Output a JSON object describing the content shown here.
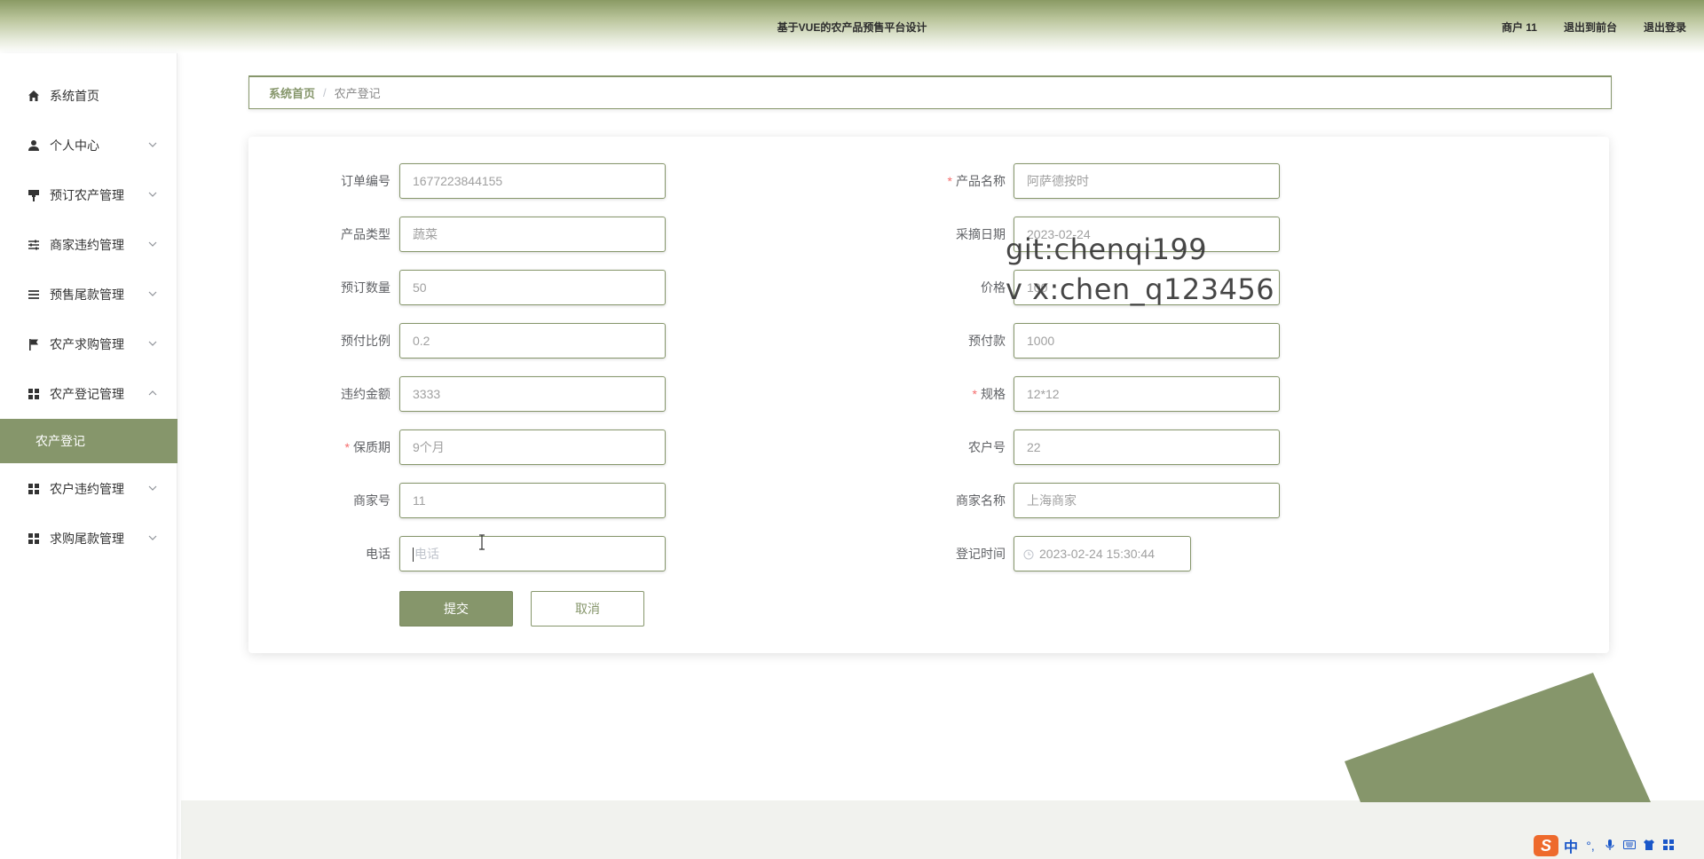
{
  "header": {
    "title": "基于VUE的农产品预售平台设计",
    "user": "商户 11",
    "to_front": "退出到前台",
    "logout": "退出登录"
  },
  "sidebar": {
    "items": [
      {
        "label": "系统首页",
        "icon": "home-icon"
      },
      {
        "label": "个人中心",
        "icon": "user-icon"
      },
      {
        "label": "预订农产管理",
        "icon": "brush-icon"
      },
      {
        "label": "商家违约管理",
        "icon": "sliders-icon"
      },
      {
        "label": "预售尾款管理",
        "icon": "list-icon"
      },
      {
        "label": "农产求购管理",
        "icon": "flag-icon"
      },
      {
        "label": "农产登记管理",
        "icon": "grid-icon"
      },
      {
        "label": "农户违约管理",
        "icon": "grid-icon"
      },
      {
        "label": "求购尾款管理",
        "icon": "grid-icon"
      }
    ],
    "active_sub": "农产登记"
  },
  "breadcrumb": {
    "home": "系统首页",
    "separator": "/",
    "current": "农产登记"
  },
  "form": {
    "order_no": {
      "label": "订单编号",
      "value": "1677223844155"
    },
    "product_name": {
      "label": "产品名称",
      "value": "阿萨德按时"
    },
    "product_type": {
      "label": "产品类型",
      "value": "蔬菜"
    },
    "pick_date": {
      "label": "采摘日期",
      "value": "2023-02-24"
    },
    "order_qty": {
      "label": "预订数量",
      "value": "50"
    },
    "price": {
      "label": "价格",
      "value": "100"
    },
    "pay_ratio": {
      "label": "预付比例",
      "value": "0.2"
    },
    "prepay": {
      "label": "预付款",
      "value": "1000"
    },
    "penalty": {
      "label": "违约金额",
      "value": "3333"
    },
    "spec": {
      "label": "规格",
      "value": "12*12"
    },
    "shelf_life": {
      "label": "保质期",
      "value": "9个月"
    },
    "farmer_no": {
      "label": "农户号",
      "value": "22"
    },
    "merchant_no": {
      "label": "商家号",
      "value": "11"
    },
    "merchant_name": {
      "label": "商家名称",
      "value": "上海商家"
    },
    "phone": {
      "label": "电话",
      "placeholder": "电话"
    },
    "register_time": {
      "label": "登记时间",
      "value": "2023-02-24 15:30:44"
    }
  },
  "buttons": {
    "submit": "提交",
    "cancel": "取消"
  },
  "watermark": {
    "line1": "git:chenqi199",
    "line2": "v x:chen_q123456"
  },
  "ime": {
    "lang": "中",
    "logo": "S"
  },
  "colors": {
    "accent": "#86966b",
    "required": "#f56c6c"
  }
}
